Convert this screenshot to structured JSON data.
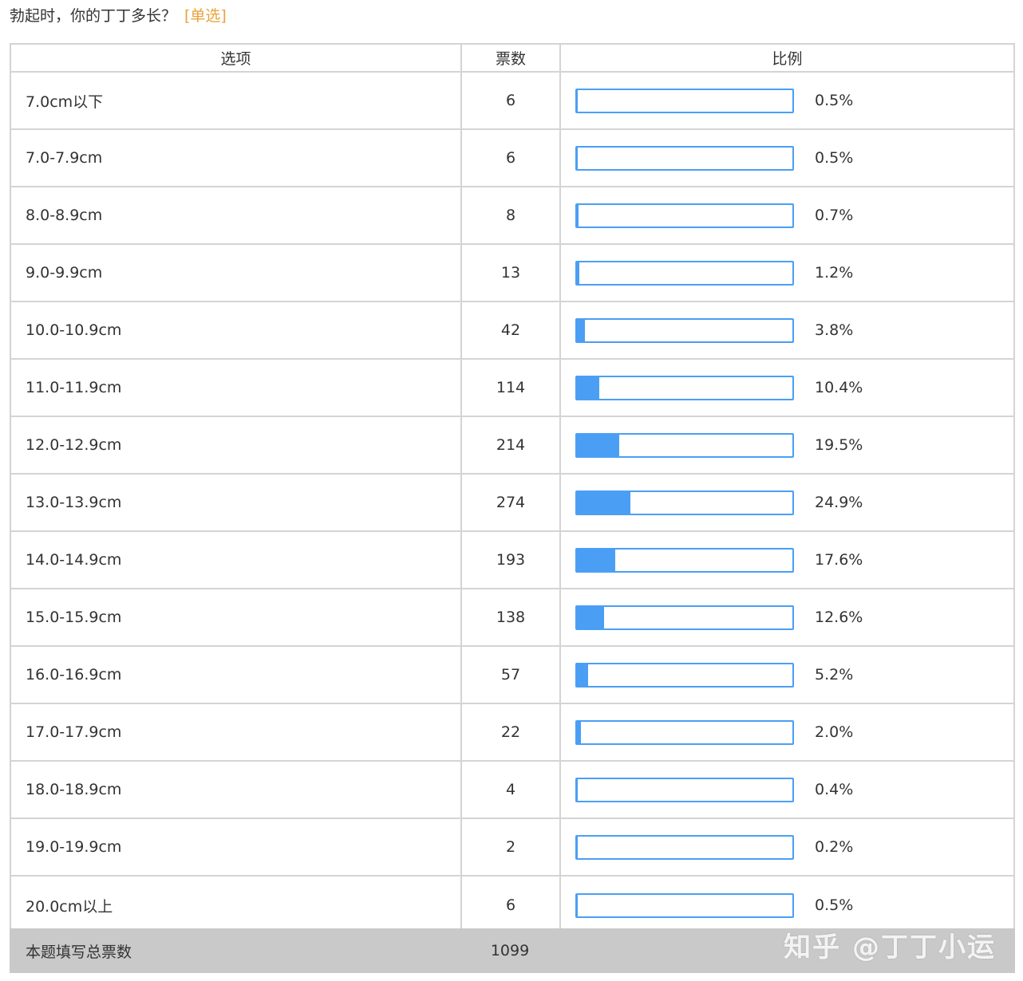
{
  "question": {
    "text": "勃起时，你的丁丁多长？",
    "type": "[单选]"
  },
  "header": {
    "option": "选项",
    "count": "票数",
    "ratio": "比例"
  },
  "chart_data": {
    "type": "table",
    "columns": [
      "选项",
      "票数",
      "比例"
    ],
    "rows": [
      {
        "option": "7.0cm以下",
        "count": "6",
        "percent": "0.5%",
        "value": 0.5
      },
      {
        "option": "7.0-7.9cm",
        "count": "6",
        "percent": "0.5%",
        "value": 0.5
      },
      {
        "option": "8.0-8.9cm",
        "count": "8",
        "percent": "0.7%",
        "value": 0.7
      },
      {
        "option": "9.0-9.9cm",
        "count": "13",
        "percent": "1.2%",
        "value": 1.2
      },
      {
        "option": "10.0-10.9cm",
        "count": "42",
        "percent": "3.8%",
        "value": 3.8
      },
      {
        "option": "11.0-11.9cm",
        "count": "114",
        "percent": "10.4%",
        "value": 10.4
      },
      {
        "option": "12.0-12.9cm",
        "count": "214",
        "percent": "19.5%",
        "value": 19.5
      },
      {
        "option": "13.0-13.9cm",
        "count": "274",
        "percent": "24.9%",
        "value": 24.9
      },
      {
        "option": "14.0-14.9cm",
        "count": "193",
        "percent": "17.6%",
        "value": 17.6
      },
      {
        "option": "15.0-15.9cm",
        "count": "138",
        "percent": "12.6%",
        "value": 12.6
      },
      {
        "option": "16.0-16.9cm",
        "count": "57",
        "percent": "5.2%",
        "value": 5.2
      },
      {
        "option": "17.0-17.9cm",
        "count": "22",
        "percent": "2.0%",
        "value": 2.0
      },
      {
        "option": "18.0-18.9cm",
        "count": "4",
        "percent": "0.4%",
        "value": 0.4
      },
      {
        "option": "19.0-19.9cm",
        "count": "2",
        "percent": "0.2%",
        "value": 0.2
      },
      {
        "option": "20.0cm以上",
        "count": "6",
        "percent": "0.5%",
        "value": 0.5
      }
    ],
    "total_label": "本题填写总票数",
    "total_value": "1099",
    "bar_color": "#4a9ff5"
  },
  "watermark": "知乎 @丁丁小运"
}
